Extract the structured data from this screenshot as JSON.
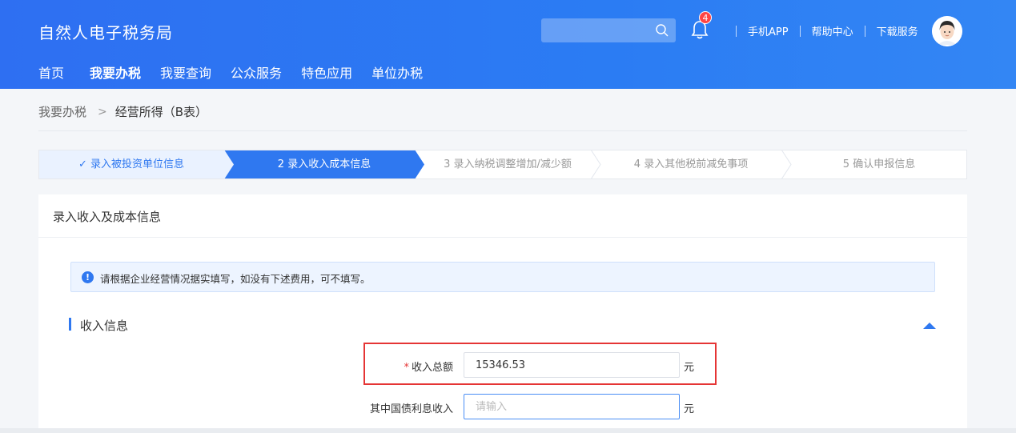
{
  "header": {
    "app_title": "自然人电子税务局",
    "nav": [
      "首页",
      "我要办税",
      "我要查询",
      "公众服务",
      "特色应用",
      "单位办税"
    ],
    "active_nav": "我要办税",
    "notification_count": "4",
    "links": [
      "手机APP",
      "帮助中心",
      "下载服务"
    ]
  },
  "breadcrumb": {
    "root": "我要办税",
    "separator": ">",
    "current": "经营所得（B表）"
  },
  "steps": [
    {
      "label": "✓ 录入被投资单位信息",
      "state": "done"
    },
    {
      "label": "2  录入收入成本信息",
      "state": "active"
    },
    {
      "label": "3  录入纳税调整增加/减少额",
      "state": "todo"
    },
    {
      "label": "4  录入其他税前减免事项",
      "state": "todo"
    },
    {
      "label": "5  确认申报信息",
      "state": "todo"
    }
  ],
  "card": {
    "title": "录入收入及成本信息",
    "notice_icon": "!",
    "notice": "请根据企业经营情况据实填写，如没有下述费用，可不填写。",
    "section_title": "收入信息"
  },
  "fields": {
    "total_income": {
      "label": "收入总额",
      "required_mark": "*",
      "value": "15346.53",
      "unit": "元"
    },
    "bond_interest": {
      "label": "其中国债利息收入",
      "placeholder": "请输入",
      "unit": "元"
    }
  },
  "colors": {
    "primary": "#2f78f0",
    "header": "#2e6ff2",
    "highlight": "#e53535",
    "done_step_bg": "#eaf2ff"
  }
}
